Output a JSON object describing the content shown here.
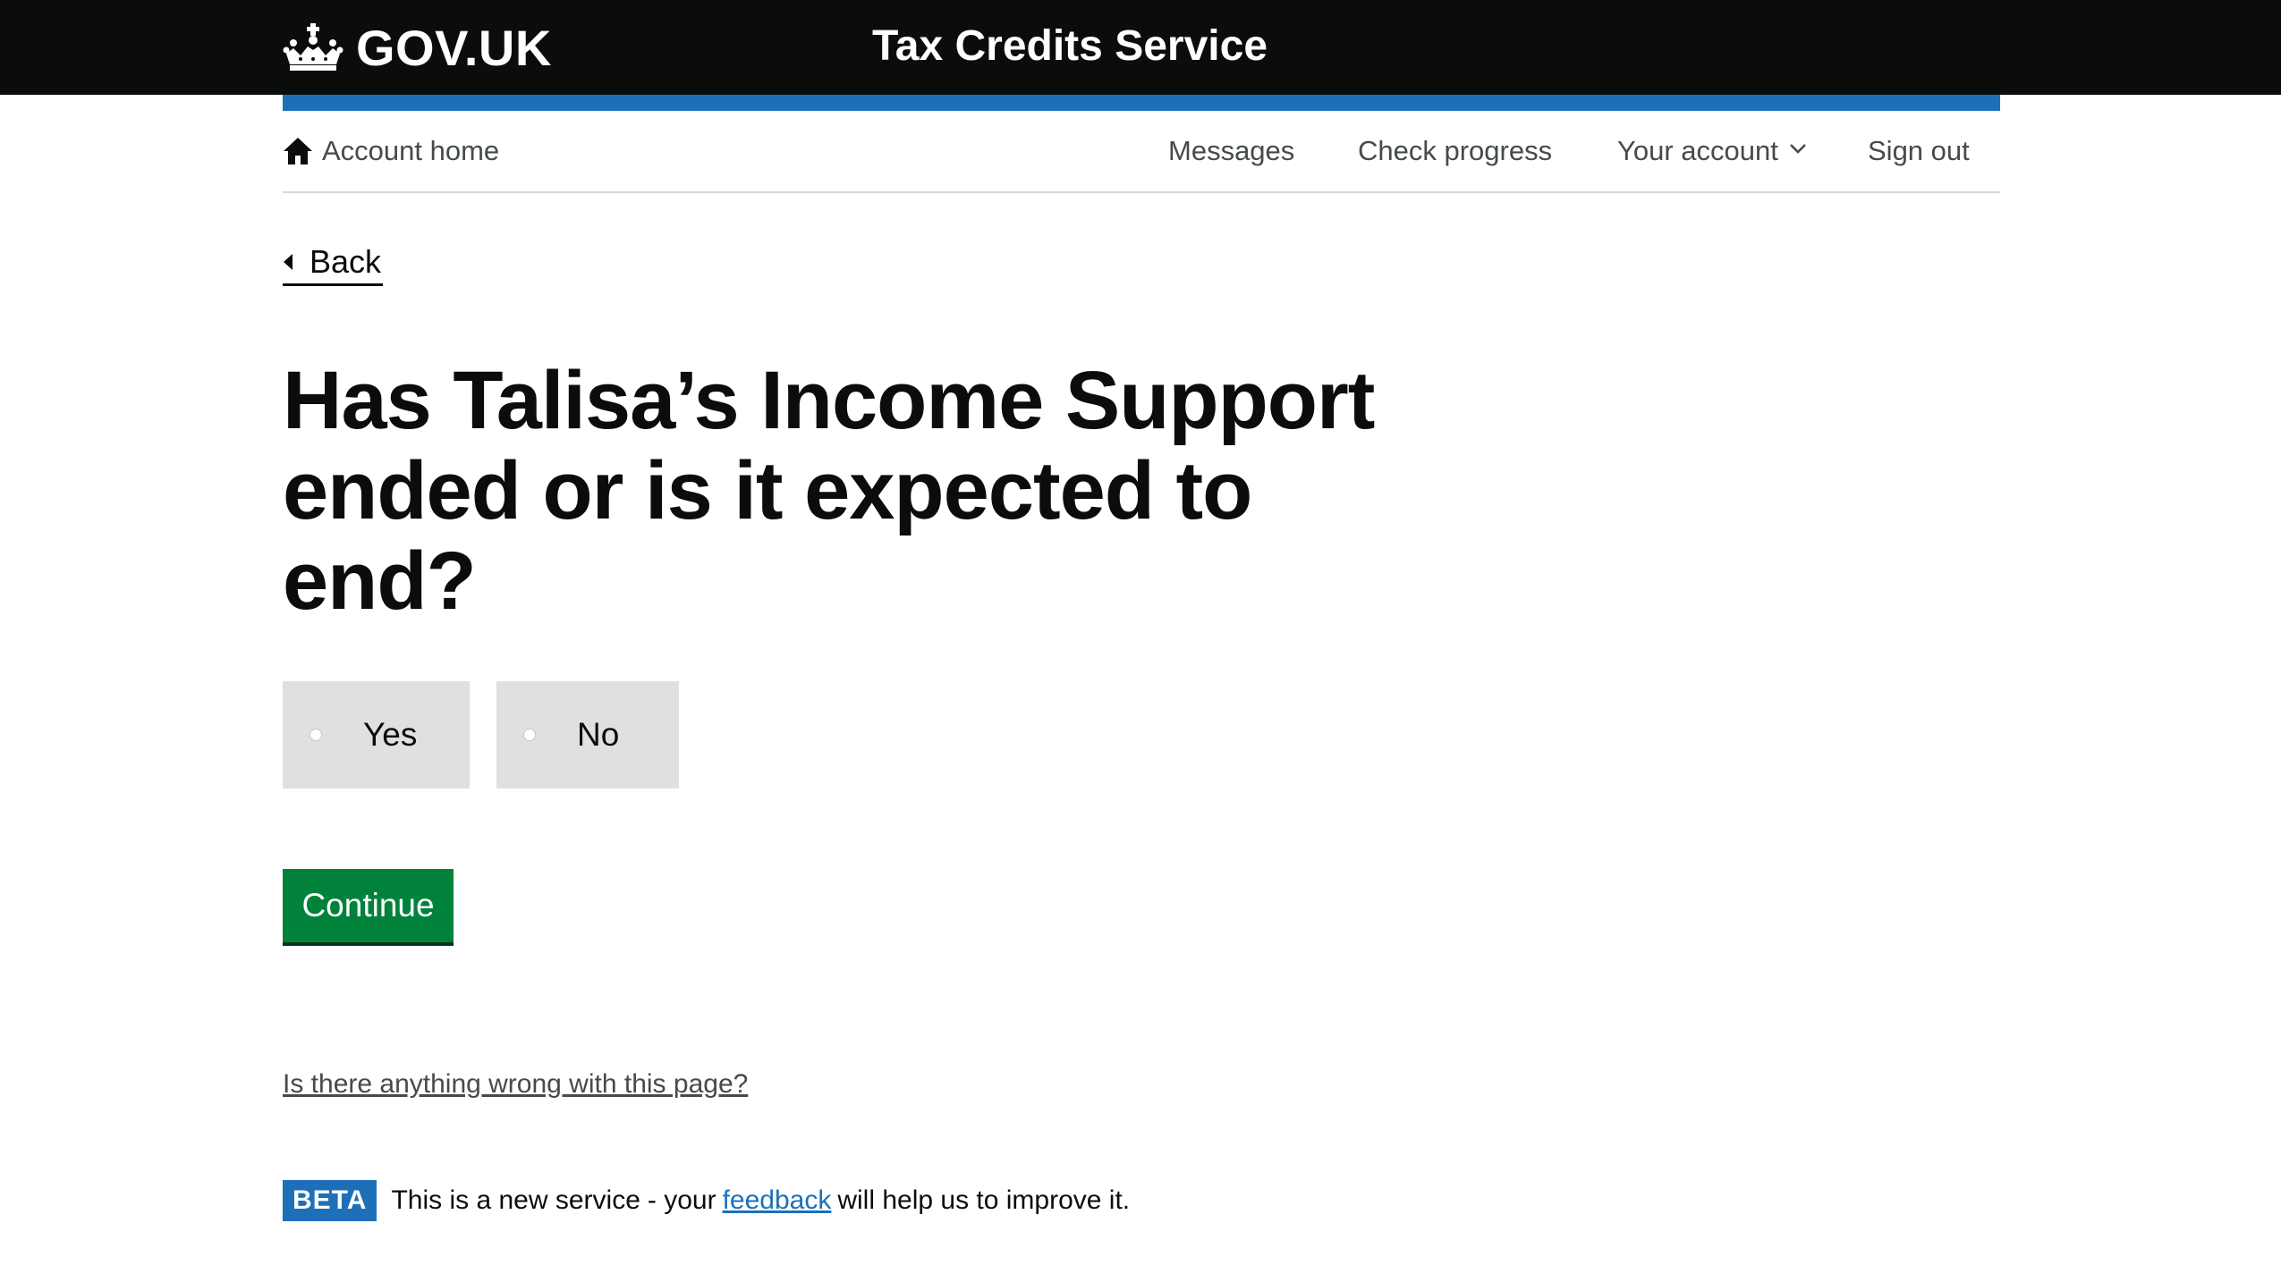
{
  "header": {
    "logo_text": "GOV.UK",
    "service_name": "Tax Credits Service",
    "background_color": "#0b0c0c",
    "stripe_color": "#1d70b8"
  },
  "nav": {
    "home_label": "Account home",
    "home_icon": "home-icon",
    "items": [
      {
        "label": "Messages"
      },
      {
        "label": "Check progress"
      },
      {
        "label": "Your account",
        "icon": "chevron-down-icon"
      },
      {
        "label": "Sign out"
      }
    ]
  },
  "back": {
    "label": "Back"
  },
  "question": {
    "heading": "Has Talisa’s Income Support ended or is it expected to end?",
    "options": [
      {
        "label": "Yes",
        "selected": false
      },
      {
        "label": "No",
        "selected": false
      }
    ]
  },
  "actions": {
    "continue_label": "Continue",
    "continue_color": "#00823b"
  },
  "footer": {
    "report_link": "Is there anything wrong with this page?",
    "beta_tag": "BETA",
    "beta_text": "This is a new service",
    "beta_text_2": "- your",
    "feedback_link": "feedback",
    "beta_text_3": "will help us to improve it."
  }
}
